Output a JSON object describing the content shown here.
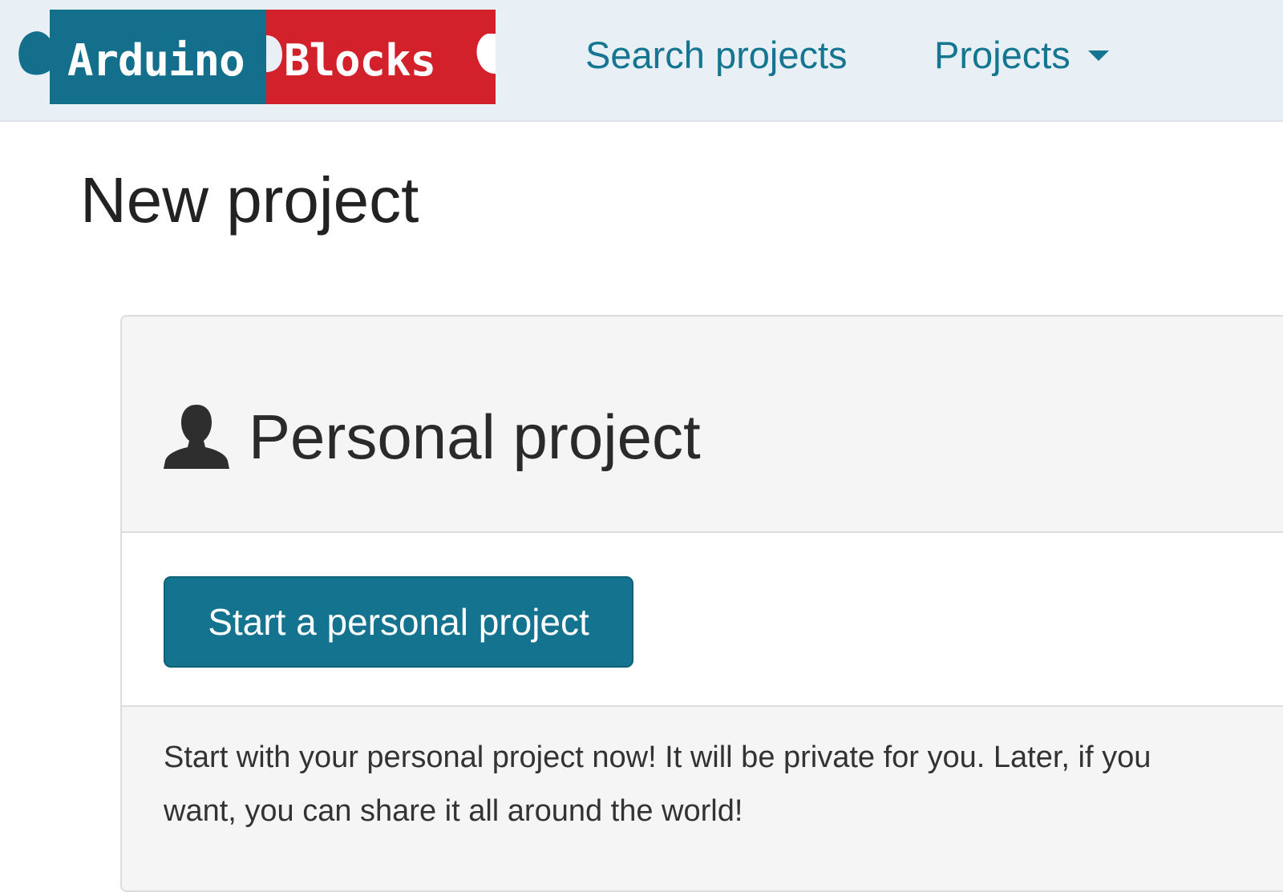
{
  "navbar": {
    "logo": {
      "part1": "Arduino",
      "part2": "Blocks",
      "colors": {
        "blue_piece": "#136f8c",
        "red_piece": "#d2212a",
        "text": "#ffffff"
      }
    },
    "links": [
      {
        "label": "Search projects"
      },
      {
        "label": "Projects",
        "icon": "caret-down-icon"
      }
    ],
    "colors": {
      "background": "#e8eff5",
      "link": "#147691"
    }
  },
  "page": {
    "title": "New project"
  },
  "panel": {
    "icon": "user-icon",
    "title": "Personal project",
    "button_label": "Start a personal project",
    "description": "Start with your personal project now! It will be private for you. Later, if you want, you can share it all around the world!",
    "colors": {
      "button": "#14738f",
      "button_text": "#ffffff",
      "heading_background": "#f5f5f5"
    }
  }
}
